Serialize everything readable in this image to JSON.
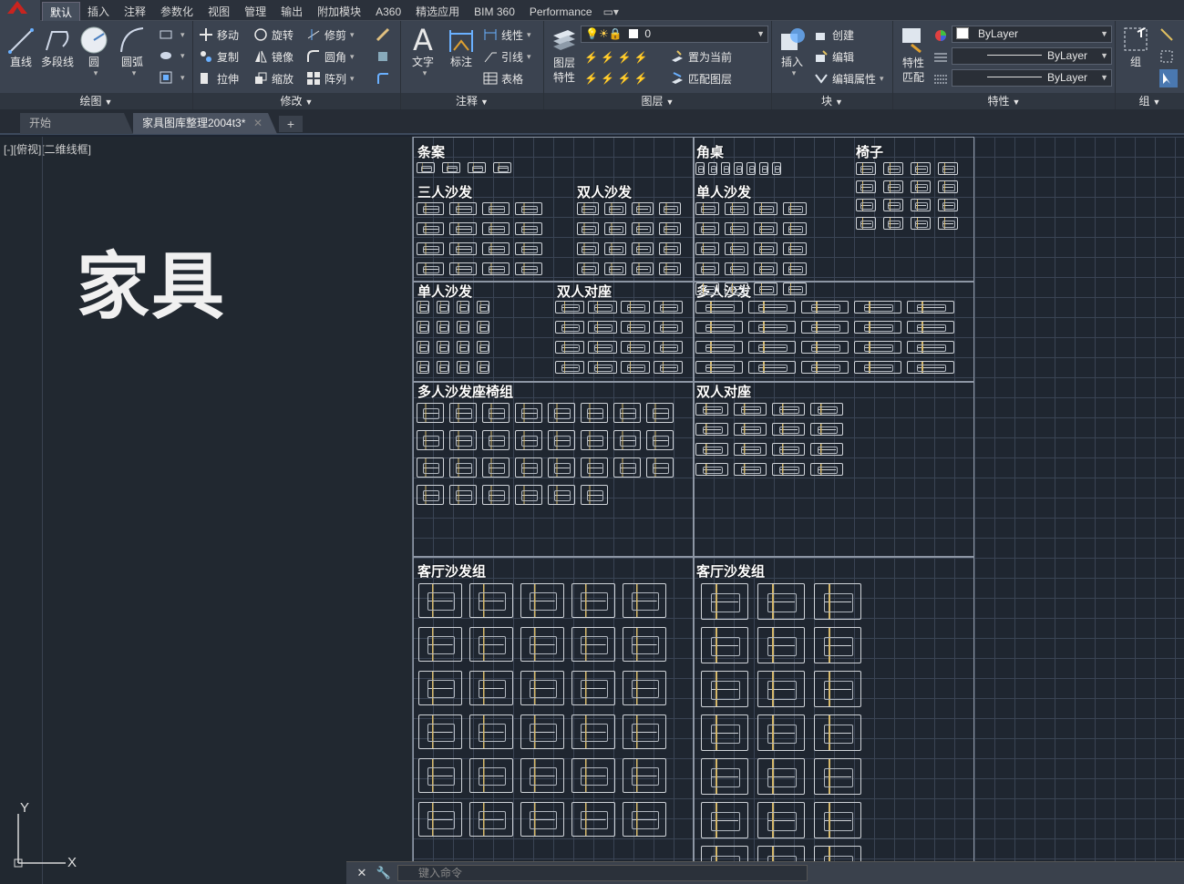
{
  "ribbon_tabs": [
    "默认",
    "插入",
    "注释",
    "参数化",
    "视图",
    "管理",
    "输出",
    "附加模块",
    "A360",
    "精选应用",
    "BIM 360",
    "Performance"
  ],
  "active_tab": "默认",
  "panels": {
    "draw": {
      "footer": "绘图",
      "line": "直线",
      "polyline": "多段线",
      "circle": "圆",
      "arc": "圆弧"
    },
    "modify": {
      "footer": "修改",
      "move": "移动",
      "rotate": "旋转",
      "trim": "修剪",
      "copy": "复制",
      "mirror": "镜像",
      "fillet": "圆角",
      "stretch": "拉伸",
      "scale": "缩放",
      "array": "阵列"
    },
    "annotation": {
      "footer": "注释",
      "text": "文字",
      "dimension": "标注",
      "linear": "线性",
      "leader": "引线",
      "table": "表格"
    },
    "layers": {
      "footer": "图层",
      "layer_props": "图层特性",
      "layer_value": "0",
      "set_current": "置为当前",
      "match_layer": "匹配图层"
    },
    "block": {
      "footer": "块",
      "insert": "插入",
      "create": "创建",
      "edit": "编辑",
      "edit_attr": "编辑属性"
    },
    "properties": {
      "footer": "特性",
      "match": "特性匹配",
      "color": "ByLayer",
      "linetype": "ByLayer",
      "lineweight": "ByLayer"
    },
    "groups": {
      "footer": "组",
      "group": "组"
    }
  },
  "file_tabs": [
    {
      "label": "开始"
    },
    {
      "label": "家具图库整理2004t3*"
    }
  ],
  "viewport_label": "[-][俯视][二维线框]",
  "drawing_title": "家具",
  "sections": [
    "条案",
    "角桌",
    "椅子",
    "三人沙发",
    "双人沙发",
    "单人沙发",
    "单人沙发",
    "双人对座",
    "多人沙发",
    "多人沙发座椅组",
    "双人对座",
    "客厅沙发组",
    "客厅沙发组"
  ],
  "ucs": {
    "y": "Y",
    "x": "X"
  },
  "command": {
    "placeholder": "键入命令"
  }
}
